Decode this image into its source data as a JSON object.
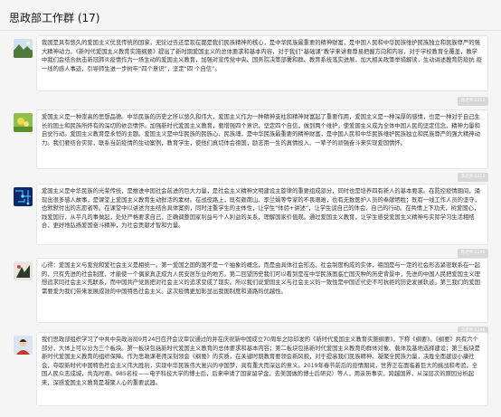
{
  "window": {
    "title": "思政部工作群 (17)"
  },
  "messages": [
    {
      "avatar": "landscape-avatar",
      "text": "我国是具有悠久的爱国主义优良传统的国家，无论过去还是现在都是我们民族精神的核心，是中华民族最重要的精神财富，是中国人民和中华民族维护民族独立和民族尊严的强大精神动力。《新时代爱国主义教育实施纲要》提出了新时期爱国主义的总体要求和基本内容，对于我们“基础课”教学来讲要尊易把握方向和内容，对于学校教育全覆盖，教学中我们会结合抗击新冠肺炎疫情作为一场生动的爱国主义教育，加强对宣传党中央、国务院决策部署和群、教育系统落实进展，加大相关政策举措解读，生动讲述教育防疫抗 疫一线的感人事迹，引导师生进一步树牢“四个意识”，坚定“四 个自信”。",
      "sender": "张老师·2213"
    },
    {
      "avatar": "flower-avatar",
      "text": "爱国主义是一种崇高的思想品德。中华民族的历史之所以悠久和伟大，爱国主义作为一种精神支柱和精神财富起了重要作用，爱国主义是一种深厚的感情，也是一种对于自己生长的国土和民族所怀有的深切的依恋情怀。加强新时代爱国主义教育，要增强四个意识，坚定四个自信，做到两个维护，使爱国主义成为全体中国人民的坚定信念、精神力量和自觉行动。爱国主义教育是永恒的主题。爱国主义是中华民族的民族心、民族魂，是中华民族最重要的精神财富，是中国人民和中华民族维护民族独立和民族尊严的强大精神动力。我们要结合实际，联系当前疫情的生动案例，教育学生，使他们真切体会祖国，励志用一生的真情投入、一辈子的顽强奋斗来实现爱国情怀。",
      "sender": "李老师·2213"
    },
    {
      "avatar": "circuit-avatar",
      "text": "爱国主义是中华民族的光荣传统，是推进中国社会前进的巨大力量，是社会主义精神文明建设主旋律的重要组成部分，同时也是培养四有新人的基本要求。在防控疫情期间，涌现出很多感人故事，是课堂上爱国主义教育生动鲜活的素材。在战役路上，既有颇南山、李兰娟等专家的不畏艰难，也有无数医护人员的奉献牺牲；既有一线工作人员的坚守，也默默付出的志愿者等。在课堂中以讲述为主结合具体案例，同时注重学生的主体性，让学生“体验+讲述”，让学生谈自己的体会、自己的行动。在共情上下功夫，树爱国心，践爱国行，从平凡的事做起，处处严格要求自己，正确调整国家利益与个人利益的关系，理解国家价值观。通过爱国主义教育，让学生感受爱国主义精神与实际学习生活相结合，更好地弘扬爱国奋斗精神，为社会贡献才智和力量。",
      "sender": "陈老师·2206"
    },
    {
      "avatar": "sunset-avatar",
      "text": "心得：爱国主义与爱党和爱社会主义是相统一。第一爱国之国的国不是一个抽象的概念，而是由具体社会形态、社会制度构成的实体，祖国是与一定的社会形态紧密联系在一起的，只有先进的社会制度，才能使一个偶家真正成为人民安居乐业的地方。第二回望历史我们可以看到是在中华民族面临亡国灭种的历史背景中，先进的中国人民把爱国主义理想追求同社会主义先联系，而中国共产党则把对社会主义的追求变成了现实。所以我们说爱国主义与社会主义的一致性是中国近代史不可抗拒的历史发展轨迹。第三我们的爱国需要爱为我们带来发展成效的中国特色社会主义。这次疫情更加彰显出我国制度和道路的优越性。",
      "sender": "刘老师·2206"
    },
    {
      "avatar": "child-avatar",
      "text": "我们思政部组织学习了中共中央政治局9月24日召开会议审议通过的并在庆祝新中国成立70周年之际印发的《新时代爱国主义教育实施纲要》，下称《纲要》。《纲要》共有六个部分，大体上可以分为三个板块。第一板块包括新时代爱国主义教育的总体要求和基本内容；第二板块包括新时代爱国主义教育的群体对象、载体及基地选择建设；第三板块是新时代爱国主义教育的组织保障。作为思政课老师深刻领会《纲要》的实质，在关键时期教育要领会新风貌，对于提高我们民族精神、凝聚全民族力量，决胜全面建设小康社会，夺取新时代中国特色社会主义伟大胜利，实现中华民族伟大复兴的中国梦，具有重大而深远的意义。2019年春节前后的疫情期间，世界正在面临着巨大的挑战和考验，全国人民众志成城，共克时艰。985名校——电子科技大学的博士后，后来申请了国家留学金，去美国做的博士后研究）等人，用亲历事实，跨越国界，从深层次的原因分析起来，深感爱国主义教育是凝聚人心的重要武器。"
    }
  ]
}
